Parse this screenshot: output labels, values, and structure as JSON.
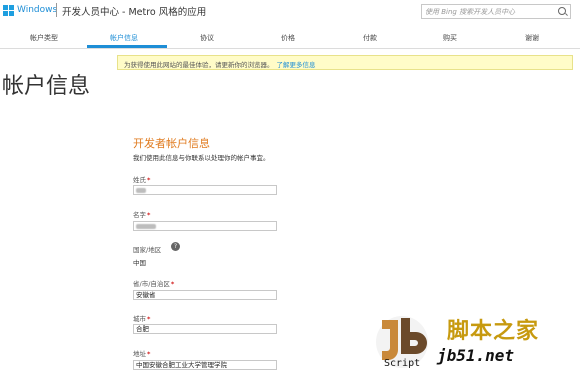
{
  "header": {
    "brand": "Windows",
    "title": "开发人员中心 - Metro 风格的应用",
    "search_placeholder": "使用 Bing 搜索开发人员中心"
  },
  "tabs": [
    {
      "label": "帐户类型",
      "active": false
    },
    {
      "label": "帐户信息",
      "active": true
    },
    {
      "label": "协议",
      "active": false
    },
    {
      "label": "价格",
      "active": false
    },
    {
      "label": "付款",
      "active": false
    },
    {
      "label": "购买",
      "active": false
    },
    {
      "label": "谢谢",
      "active": false
    }
  ],
  "banner": {
    "text": "为获得使用此网站的最佳体验，请更新你的浏览器。",
    "link": "了解更多信息"
  },
  "page_title": "帐户信息",
  "form": {
    "section_title": "开发者帐户信息",
    "section_desc": "我们使用此信息与你联系以处理你的帐户事宜。",
    "fields": [
      {
        "label": "姓氏",
        "required": "*",
        "value": ""
      },
      {
        "label": "名字",
        "required": "*",
        "value": ""
      },
      {
        "label": "国家/地区",
        "help": "?",
        "value": "中国"
      },
      {
        "label": "省/市/自治区",
        "required": "*",
        "value": "安徽省"
      },
      {
        "label": "城市",
        "required": "*",
        "value": "合肥"
      },
      {
        "label": "地址",
        "required": "*",
        "value": "中国安徽合肥工业大学管理学院"
      }
    ]
  },
  "watermark": {
    "script": "Script",
    "cn": "脚本之家",
    "site": "jb51.net"
  },
  "colors": {
    "accent": "#1e8ed6",
    "section_title": "#e07b1f",
    "required": "#d41f1f",
    "banner_bg": "#fffcc8"
  }
}
